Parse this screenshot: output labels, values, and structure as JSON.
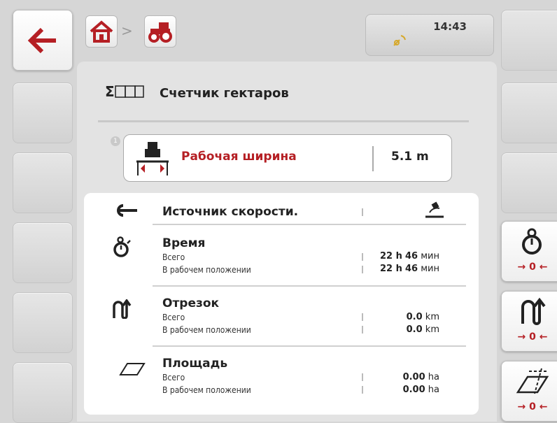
{
  "header": {
    "breadcrumb_separator": ">",
    "time": "14:43"
  },
  "screen": {
    "title": "Счетчик гектаров",
    "title_icon": "sum-counter-icon"
  },
  "working_width": {
    "index_badge": "1",
    "label": "Рабочая ширина",
    "value": "5.1 m"
  },
  "speed_source": {
    "label": "Источник скорости.",
    "icon": "radar-sensor-icon"
  },
  "time_counter": {
    "title": "Время",
    "total_label": "Всего",
    "working_label": "В рабочем положении",
    "total_h": "22 h",
    "total_m": "46",
    "working_h": "22 h",
    "working_m": "46",
    "unit_min": "мин"
  },
  "distance_counter": {
    "title": "Отрезок",
    "total_label": "Всего",
    "working_label": "В рабочем положении",
    "total_value": "0.0",
    "working_value": "0.0",
    "unit": "km"
  },
  "area_counter": {
    "title": "Площадь",
    "total_label": "Всего",
    "working_label": "В рабочем положении",
    "total_value": "0.00",
    "working_value": "0.00",
    "unit": "ha"
  },
  "softkeys": {
    "reset_label": "→ 0 ←"
  },
  "colors": {
    "accent_red": "#b51f24",
    "background": "#d6d6d6",
    "panel": "#ffffff"
  }
}
